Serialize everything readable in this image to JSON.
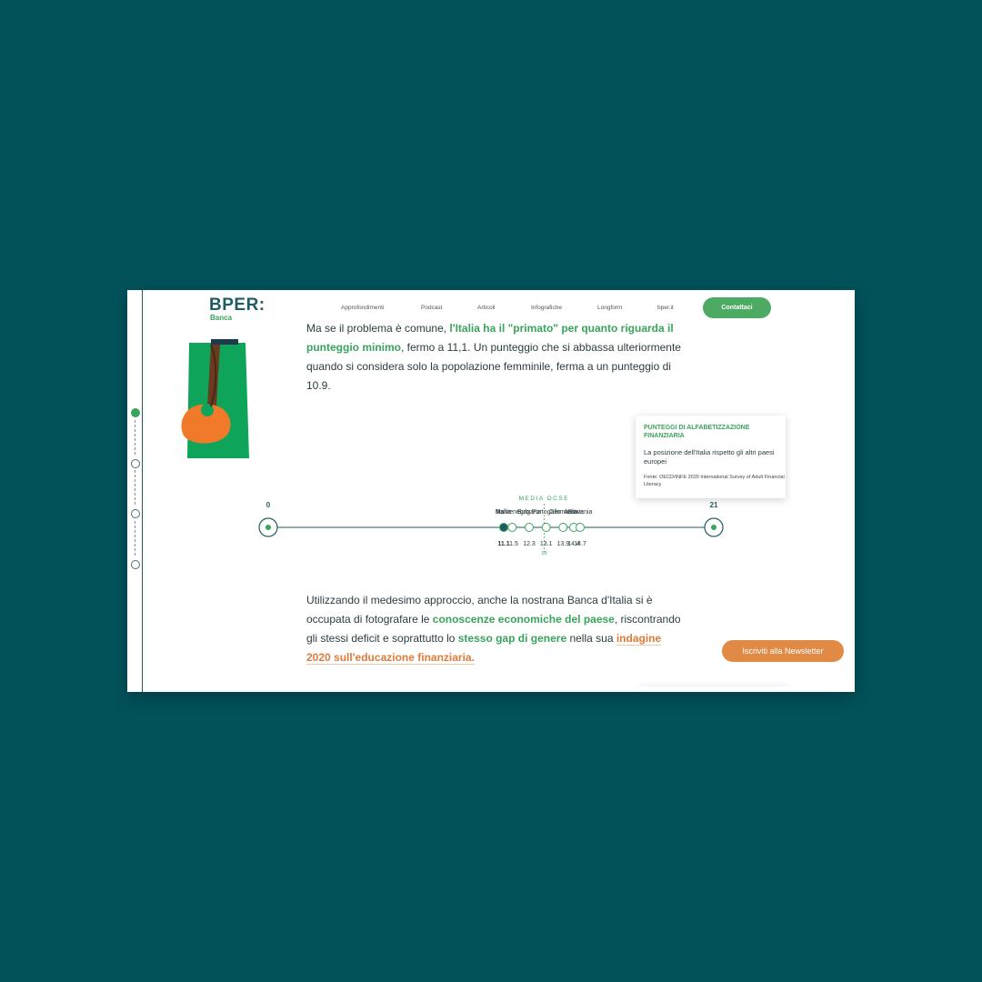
{
  "header": {
    "logo": "BPER:",
    "logo_sub": "Banca",
    "nav": [
      "Approfondimenti",
      "Podcast",
      "Articoli",
      "Infografiche",
      "Longform",
      "bper.it"
    ],
    "contact": "Contattaci"
  },
  "paragraph1": {
    "p1": "Ma se il problema è comune, ",
    "h1": "l'Italia ha il \"primato\" per quanto riguarda il punteggio minimo",
    "p2": ", fermo a 11,1. Un punteggio che si abbassa ulteriormente quando si considera solo la popolazione femminile, ferma a un punteggio di 10.9."
  },
  "card": {
    "title": "PUNTEGGI DI ALFABETIZZAZIONE FINANZIARIA",
    "desc": "La posizione dell'Italia rispetto gli altri paesi europei",
    "source": "Fonte: OECD/INFE 2020 International Survey of Adult Financial Literacy"
  },
  "chart_data": {
    "type": "scatter",
    "scale_min": 0,
    "scale_max": 21,
    "average_label": "MEDIA OCSE",
    "average_value": 13,
    "highlight": "Italia",
    "points": [
      {
        "country": "Italia",
        "value": 11.1,
        "value_label": "11.1"
      },
      {
        "country": "Montenegro",
        "value": 11.5,
        "value_label": "11.5"
      },
      {
        "country": "Bulgaria",
        "value": 12.3,
        "value_label": "12.3"
      },
      {
        "country": "Portogallo",
        "value": 13.1,
        "value_label": "13.1"
      },
      {
        "country": "Germania",
        "value": 13.9,
        "value_label": "13.9"
      },
      {
        "country": "Austria",
        "value": 14.4,
        "value_label": "14.4"
      },
      {
        "country": "Slovenia",
        "value": 14.7,
        "value_label": "14.7"
      }
    ],
    "colors": {
      "axis": "#1f5b63",
      "accent": "#3aa35c",
      "highlight": "#1f5b63"
    }
  },
  "paragraph2": {
    "p1": "Utilizzando il medesimo approccio, anche la nostrana Banca d'Italia si è occupata di fotografare le ",
    "h1": "conoscenze economiche del paese",
    "p2": ", riscontrando gli stessi deficit e soprattutto lo ",
    "h2": "stesso gap di genere",
    "p3": " nella sua ",
    "h3": "indagine 2020 sull'educazione finanziaria."
  },
  "newsletter": "Iscriviti alla Newsletter"
}
